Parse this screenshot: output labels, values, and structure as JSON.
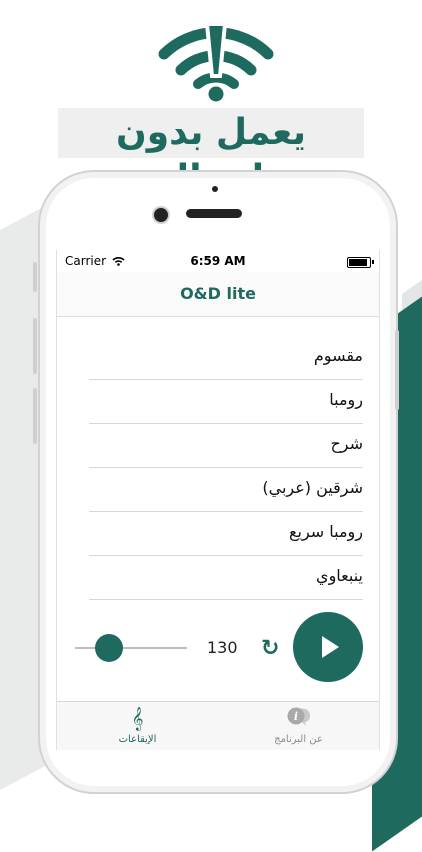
{
  "promo": {
    "headline": "يعمل بدون اتصال",
    "accent_color": "#1f6a5f"
  },
  "status_bar": {
    "carrier": "Carrier",
    "time": "6:59 AM"
  },
  "nav": {
    "title": "O&D lite"
  },
  "rhythms": [
    {
      "label": "مقسوم"
    },
    {
      "label": "رومبا"
    },
    {
      "label": "شرح"
    },
    {
      "label": "شرقين (عربي)"
    },
    {
      "label": "رومبا سريع"
    },
    {
      "label": "ينبعاوي"
    }
  ],
  "controls": {
    "tempo": "130",
    "tempo_slider_level": 0.3,
    "reset_icon": "refresh-icon",
    "play_icon": "play-icon"
  },
  "tabs": [
    {
      "label": "الإيقاعات",
      "icon": "treble-clef-icon",
      "active": true
    },
    {
      "label": "عن البرنامج",
      "icon": "info-chat-icon",
      "active": false
    }
  ]
}
